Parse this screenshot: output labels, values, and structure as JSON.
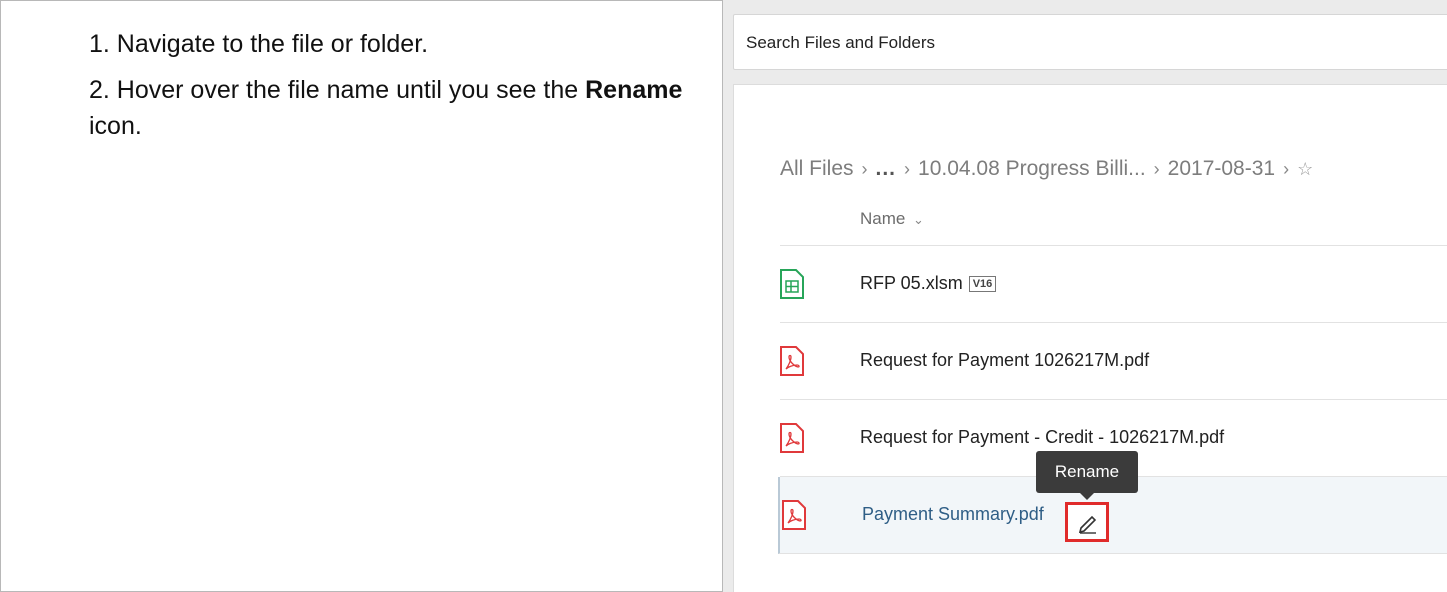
{
  "instructions": {
    "step1": "1. Navigate to the file or folder.",
    "step2_prefix": "2. Hover over the file name until you see the",
    "step2_bold": "Rename",
    "step2_suffix": "icon."
  },
  "screenshot": {
    "search_text": "Search Files and Folders",
    "breadcrumb": [
      "All Files",
      "...",
      "10.04.08 Progress Billi...",
      "2017-08-31"
    ],
    "column_header": "Name",
    "files": [
      {
        "name": "RFP 05.xlsm",
        "badge": "V16",
        "icon": "spreadsheet-icon",
        "selected": false
      },
      {
        "name": "Request for Payment 1026217M.pdf",
        "icon": "pdf-icon",
        "selected": false
      },
      {
        "name": "Request for Payment - Credit - 1026217M.pdf",
        "icon": "pdf-icon",
        "selected": false
      },
      {
        "name": "Payment Summary.pdf",
        "icon": "pdf-icon",
        "selected": true
      }
    ],
    "tooltip": "Rename",
    "colors": {
      "pdf": "#e0393b",
      "spreadsheet": "#27a559",
      "highlight": "#e02b2b",
      "link": "#2f5e86"
    }
  }
}
